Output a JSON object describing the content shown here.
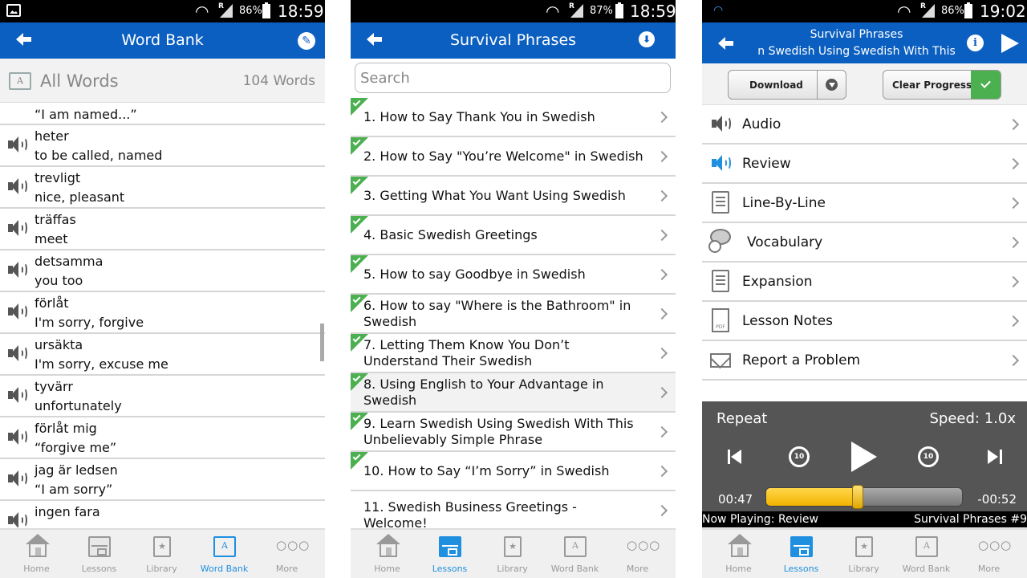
{
  "screens": {
    "word_bank": {
      "status": {
        "battery": "86%",
        "time": "18:59"
      },
      "title": "Word Bank",
      "all_words_label": "All Words",
      "word_count": "104 Words",
      "words": [
        {
          "word": "“I am named...”",
          "meaning": ""
        },
        {
          "word": "heter",
          "meaning": "to be called, named"
        },
        {
          "word": "trevligt",
          "meaning": "nice, pleasant"
        },
        {
          "word": "träffas",
          "meaning": "meet"
        },
        {
          "word": "detsamma",
          "meaning": "you too"
        },
        {
          "word": "förlåt",
          "meaning": "I'm sorry, forgive"
        },
        {
          "word": "ursäkta",
          "meaning": "I'm sorry, excuse me"
        },
        {
          "word": "tyvärr",
          "meaning": "unfortunately"
        },
        {
          "word": "förlåt mig",
          "meaning": "“forgive me”"
        },
        {
          "word": "jag är ledsen",
          "meaning": "“I am sorry”"
        },
        {
          "word": "ingen fara",
          "meaning": ""
        }
      ],
      "tabs": [
        "Home",
        "Lessons",
        "Library",
        "Word Bank",
        "More"
      ],
      "active_tab": "Word Bank"
    },
    "survival_phrases": {
      "status": {
        "battery": "87%",
        "time": "18:59"
      },
      "title": "Survival Phrases",
      "search_placeholder": "Search",
      "lessons": [
        {
          "title": "1. How to Say Thank You in Swedish",
          "completed": true
        },
        {
          "title": "2. How to Say \"You’re Welcome\" in Swedish",
          "completed": true
        },
        {
          "title": "3. Getting What You Want Using Swedish",
          "completed": true
        },
        {
          "title": "4. Basic Swedish Greetings",
          "completed": true
        },
        {
          "title": "5. How to say Goodbye in Swedish",
          "completed": true
        },
        {
          "title": "6. How to say \"Where is the Bathroom\" in Swedish",
          "completed": true
        },
        {
          "title": "7. Letting Them Know You Don’t Understand Their Swedish",
          "completed": true
        },
        {
          "title": "8. Using English to Your Advantage in Swedish",
          "completed": true
        },
        {
          "title": "9. Learn Swedish Using Swedish With This Unbelievably Simple Phrase",
          "completed": true
        },
        {
          "title": "10. How to Say “I’m Sorry” in Swedish",
          "completed": true
        },
        {
          "title": "11. Swedish Business Greetings - Welcome!",
          "completed": false
        }
      ],
      "tabs": [
        "Home",
        "Lessons",
        "Library",
        "Word Bank",
        "More"
      ],
      "active_tab": "Lessons"
    },
    "lesson": {
      "status": {
        "battery": "86%",
        "time": "19:02"
      },
      "title_line1": "Survival Phrases",
      "title_line2": "n Swedish Using Swedish With This",
      "download_label": "Download",
      "clear_progress_label": "Clear Progress",
      "menu": [
        {
          "label": "Audio",
          "icon": "speaker-icon"
        },
        {
          "label": "Review",
          "icon": "speaker-blue-icon"
        },
        {
          "label": "Line-By-Line",
          "icon": "line-by-line-icon"
        },
        {
          "label": "Vocabulary",
          "icon": "vocabulary-icon"
        },
        {
          "label": "Expansion",
          "icon": "expansion-icon"
        },
        {
          "label": "Lesson Notes",
          "icon": "pdf-icon"
        },
        {
          "label": "Report a Problem",
          "icon": "mail-icon"
        }
      ],
      "player": {
        "repeat_label": "Repeat",
        "speed_label": "Speed: 1.0x",
        "rewind_label": "10",
        "forward_label": "10",
        "elapsed": "00:47",
        "remaining": "-00:52",
        "progress": 0.47,
        "now_playing": "Now Playing: Review",
        "lesson_tag": "Survival Phrases #9"
      },
      "tabs": [
        "Home",
        "Lessons",
        "Library",
        "Word Bank",
        "More"
      ],
      "active_tab": "Lessons"
    }
  },
  "colors": {
    "brand_blue": "#0b5fc0",
    "active_tab": "#1f8fe0",
    "complete_green": "#4caf50",
    "progress_yellow": "#f2b400"
  }
}
